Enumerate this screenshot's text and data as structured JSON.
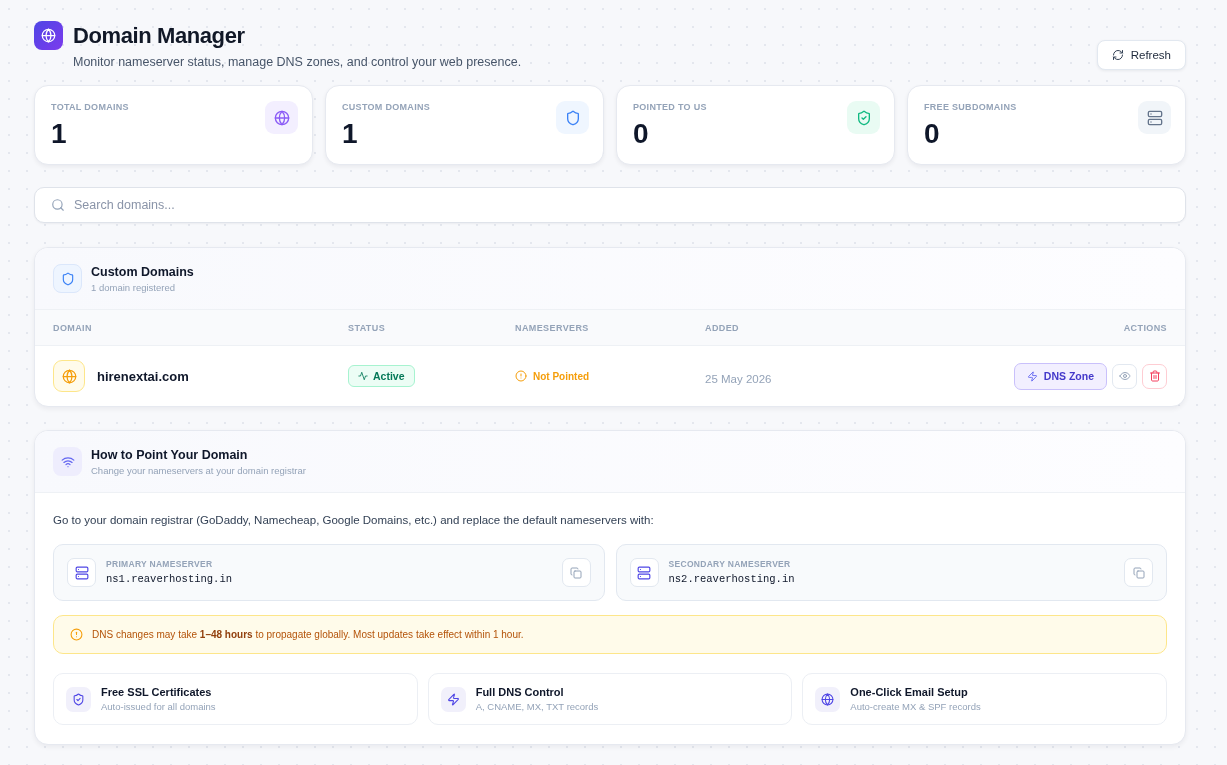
{
  "header": {
    "title": "Domain Manager",
    "subtitle": "Monitor nameserver status, manage DNS zones, and control your web presence.",
    "refresh_button": "Refresh"
  },
  "stats": [
    {
      "label": "TOTAL DOMAINS",
      "value": "1",
      "kind": "globe"
    },
    {
      "label": "CUSTOM DOMAINS",
      "value": "1",
      "kind": "shield"
    },
    {
      "label": "POINTED TO US",
      "value": "0",
      "kind": "shield-check"
    },
    {
      "label": "FREE SUBDOMAINS",
      "value": "0",
      "kind": "server"
    }
  ],
  "search": {
    "placeholder": "Search domains..."
  },
  "custom_domains": {
    "title": "Custom Domains",
    "subtitle": "1 domain registered",
    "columns": [
      "DOMAIN",
      "STATUS",
      "NAMESERVERS",
      "ADDED",
      "ACTIONS"
    ],
    "rows": [
      {
        "domain": "hirenextai.com",
        "status": "Active",
        "nameservers": "Not Pointed",
        "added": "25 May 2026",
        "dns_zone_button": "DNS Zone"
      }
    ]
  },
  "how_to_point": {
    "title": "How to Point Your Domain",
    "subtitle": "Change your nameservers at your domain registrar",
    "intro": "Go to your domain registrar (GoDaddy, Namecheap, Google Domains, etc.) and replace the default nameservers with:",
    "nameservers": [
      {
        "label": "PRIMARY NAMESERVER",
        "value": "ns1.reaverhosting.in"
      },
      {
        "label": "SECONDARY NAMESERVER",
        "value": "ns2.reaverhosting.in"
      }
    ],
    "notice": "DNS changes may take **1–48 hours** to propagate globally. Most updates take effect within 1 hour.",
    "features": [
      {
        "title": "Free SSL Certificates",
        "subtitle": "Auto-issued for all domains",
        "kind": "shield-check"
      },
      {
        "title": "Full DNS Control",
        "subtitle": "A, CNAME, MX, TXT records",
        "kind": "bolt"
      },
      {
        "title": "One-Click Email Setup",
        "subtitle": "Auto-create MX & SPF records",
        "kind": "globe"
      }
    ]
  }
}
